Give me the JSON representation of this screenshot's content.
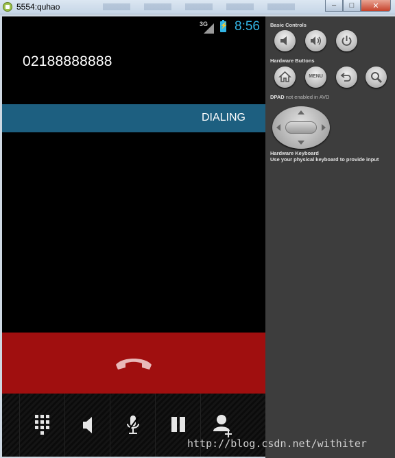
{
  "window": {
    "title": "5554:quhao"
  },
  "status_bar": {
    "network": "3G",
    "time": "8:56"
  },
  "call": {
    "number": "02188888888",
    "state": "DIALING"
  },
  "bottom_buttons": [
    {
      "name": "dialpad-icon"
    },
    {
      "name": "speaker-icon"
    },
    {
      "name": "mute-icon"
    },
    {
      "name": "hold-icon"
    },
    {
      "name": "add-call-icon"
    }
  ],
  "controls": {
    "basic_title": "Basic Controls",
    "hardware_title": "Hardware Buttons",
    "menu_label": "MENU",
    "dpad_title": "DPAD",
    "dpad_sub": "not enabled in AVD",
    "keyboard_title": "Hardware Keyboard",
    "keyboard_sub": "Use your physical keyboard to provide input"
  },
  "watermark": "http://blog.csdn.net/withiter",
  "colors": {
    "dialing_banner": "#1d5f80",
    "end_call": "#a00f0f",
    "status_accent": "#33b5e5"
  }
}
